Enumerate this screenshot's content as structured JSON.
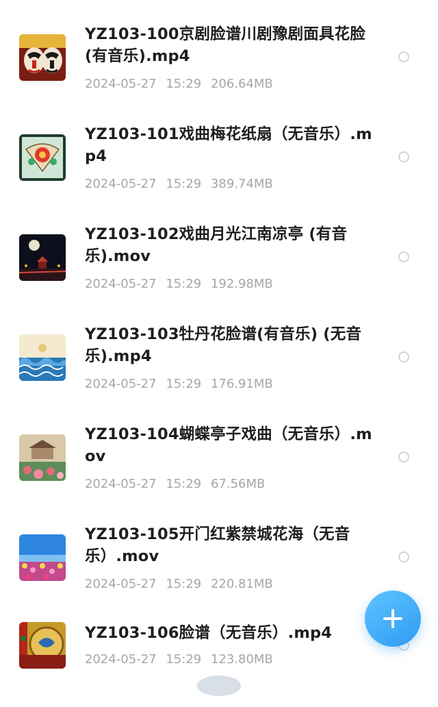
{
  "files": [
    {
      "title": "YZ103-100京剧脸谱川剧豫剧面具花脸 (有音乐).mp4",
      "date": "2024-05-27",
      "time": "15:29",
      "size": "206.64MB",
      "thumb": "opera-mask-thumbnail"
    },
    {
      "title": "YZ103-101戏曲梅花纸扇（无音乐）.mp4",
      "date": "2024-05-27",
      "time": "15:29",
      "size": "389.74MB",
      "thumb": "plum-fan-thumbnail"
    },
    {
      "title": "YZ103-102戏曲月光江南凉亭 (有音乐).mov",
      "date": "2024-05-27",
      "time": "15:29",
      "size": "192.98MB",
      "thumb": "moonlight-pavilion-thumbnail"
    },
    {
      "title": "YZ103-103牡丹花脸谱(有音乐) (无音乐).mp4",
      "date": "2024-05-27",
      "time": "15:29",
      "size": "176.91MB",
      "thumb": "peony-waves-thumbnail"
    },
    {
      "title": "YZ103-104蝴蝶亭子戏曲（无音乐）.mov",
      "date": "2024-05-27",
      "time": "15:29",
      "size": "67.56MB",
      "thumb": "butterfly-pavilion-thumbnail"
    },
    {
      "title": "YZ103-105开门红紫禁城花海（无音乐）.mov",
      "date": "2024-05-27",
      "time": "15:29",
      "size": "220.81MB",
      "thumb": "forbidden-city-flowers-thumbnail"
    },
    {
      "title": "YZ103-106脸谱（无音乐）.mp4",
      "date": "2024-05-27",
      "time": "15:29",
      "size": "123.80MB",
      "thumb": "mask-dragon-thumbnail"
    }
  ],
  "fab": {
    "icon": "plus-icon",
    "color": "#2f9bf2"
  }
}
